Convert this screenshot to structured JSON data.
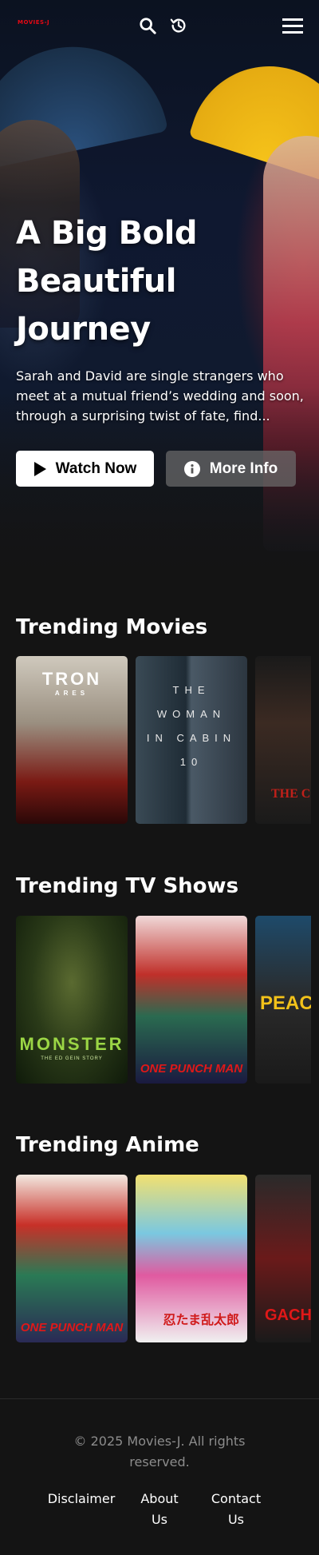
{
  "header": {
    "logo_text": "MOVIES-J",
    "icons": [
      "search-icon",
      "history-icon",
      "menu-icon"
    ]
  },
  "hero": {
    "title": "A Big Bold Beautiful Journey",
    "description": "Sarah and David are single strangers who meet at a mutual friend’s wedding and soon, through a surprising twist of fate, find...",
    "watch_label": "Watch Now",
    "info_label": "More Info"
  },
  "sections": {
    "movies": {
      "title": "Trending Movies",
      "posters": [
        {
          "text": "TRON",
          "sub": "ARES"
        },
        {
          "text": "THE WOMAN IN CABIN 10"
        },
        {
          "text": "THE CONJU"
        }
      ]
    },
    "tv": {
      "title": "Trending TV Shows",
      "posters": [
        {
          "text": "MONSTER",
          "sub": "THE ED GEIN STORY"
        },
        {
          "text": "ONE PUNCH MAN"
        },
        {
          "text": "PEACE"
        }
      ]
    },
    "anime": {
      "title": "Trending Anime",
      "posters": [
        {
          "text": "ONE PUNCH MAN"
        },
        {
          "text": "忍たま乱太郎"
        },
        {
          "text": "GACHI"
        }
      ]
    }
  },
  "footer": {
    "copyright": "© 2025 Movies-J. All rights reserved.",
    "links": [
      "Disclaimer",
      "About Us",
      "Contact Us"
    ]
  },
  "colors": {
    "background": "#141414",
    "brand": "#e50914"
  }
}
